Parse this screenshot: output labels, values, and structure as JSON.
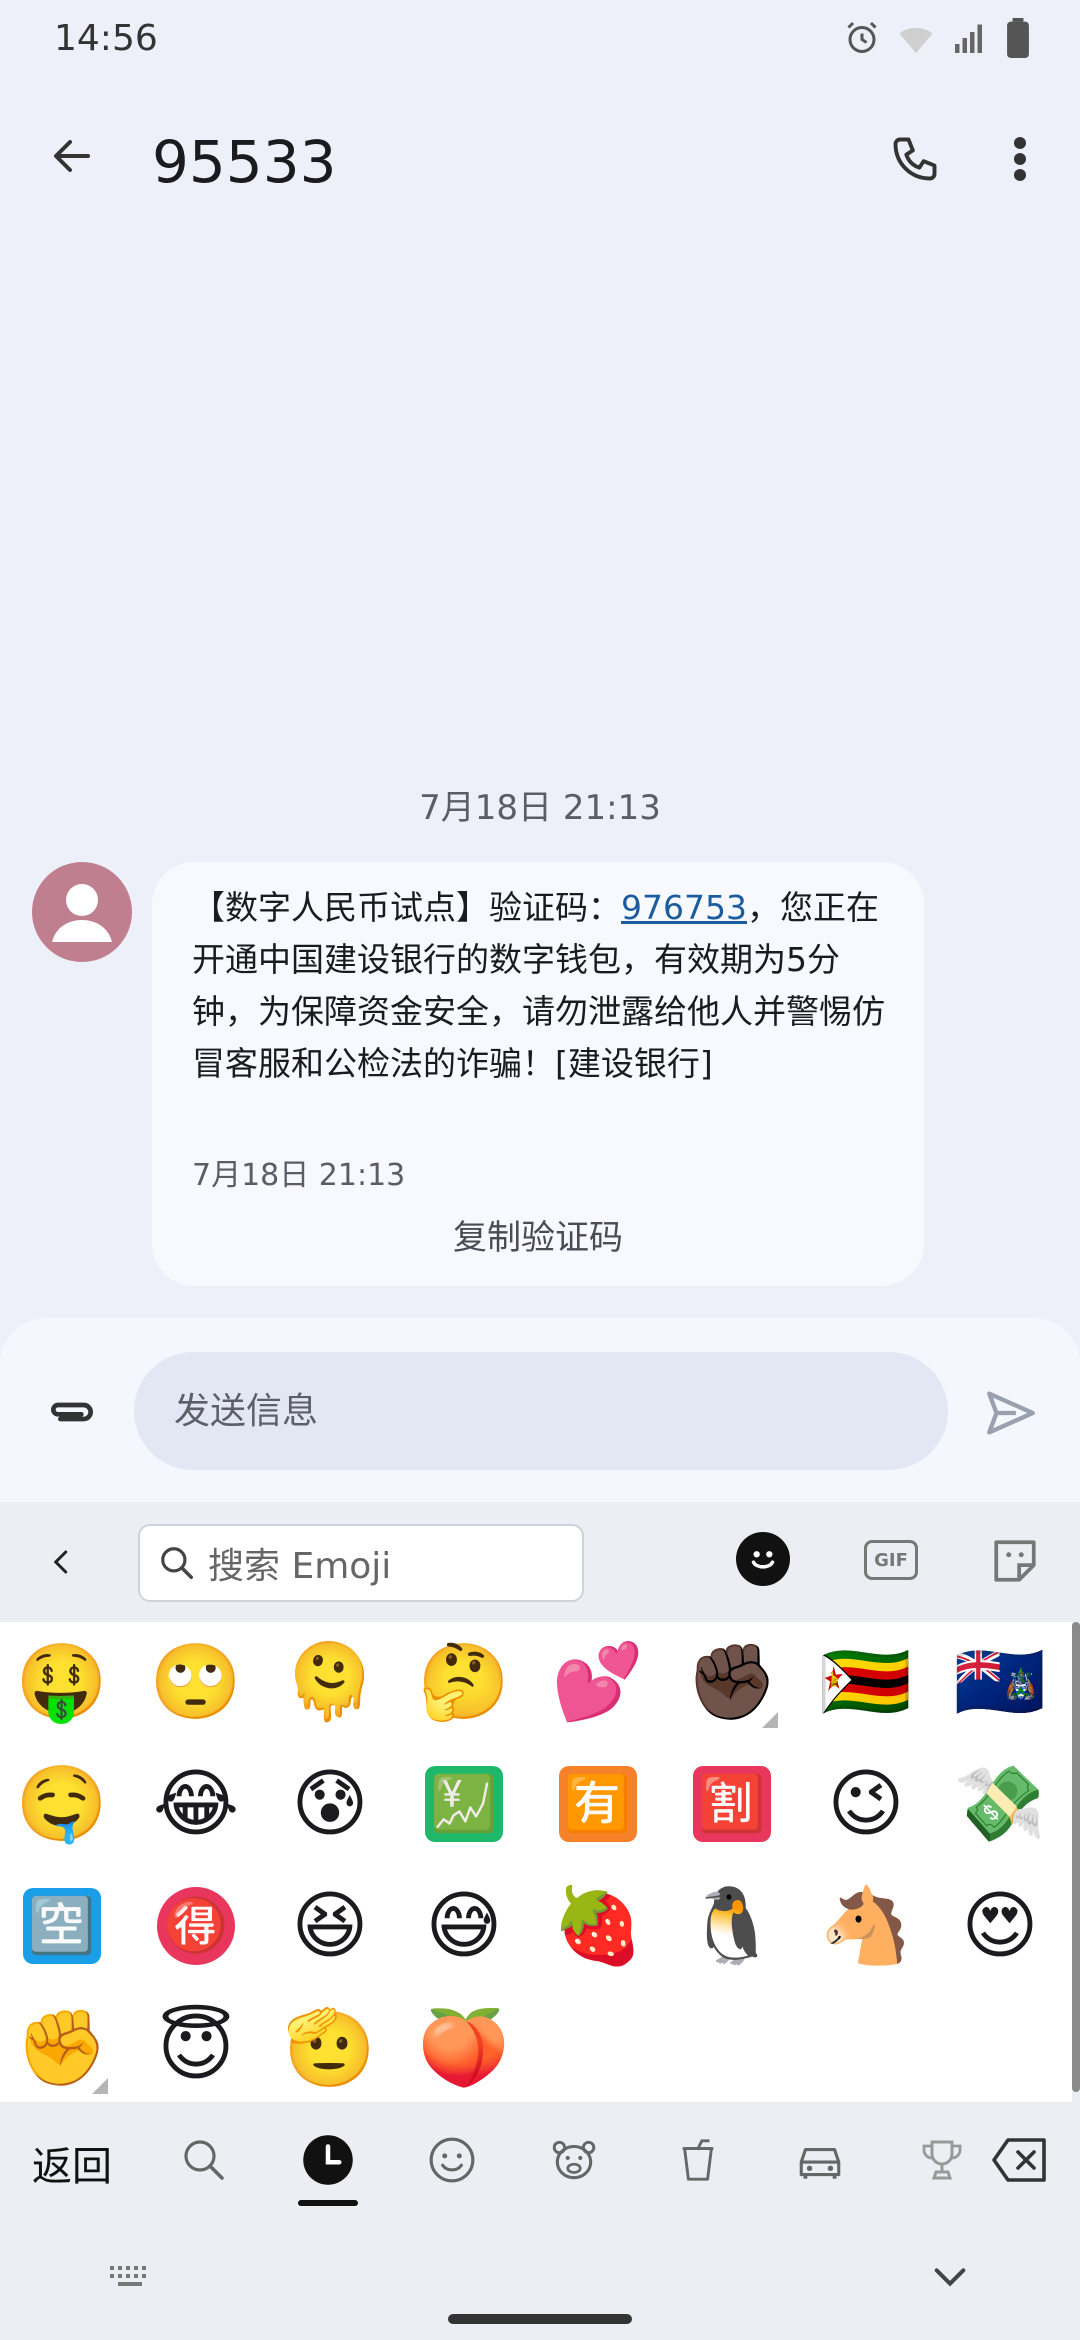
{
  "status_bar": {
    "time": "14:56"
  },
  "app_bar": {
    "title": "95533"
  },
  "conversation": {
    "date_separator": "7月18日 21:13",
    "message": {
      "text_before_code": "【数字人民币试点】验证码：",
      "code": "976753",
      "text_after_code": "，您正在开通中国建设银行的数字钱包，有效期为5分钟，为保障资金安全，请勿泄露给他人并警惕仿冒客服和公检法的诈骗！[建设银行]",
      "time": "7月18日 21:13",
      "copy_code_label": "复制验证码"
    }
  },
  "composer": {
    "placeholder": "发送信息"
  },
  "keyboard": {
    "search_placeholder": "搜索 Emoji",
    "gif_label": "GIF",
    "return_label": "返回",
    "emojis": [
      "🤑",
      "🙄",
      "🫠",
      "🤔",
      "💕",
      "✊🏿",
      "🇿🇼",
      "🇦🇨",
      "🤤",
      "😂",
      "😰",
      "💹",
      "🈶",
      "🈹",
      "😉",
      "💸",
      "🈳",
      "🉐",
      "😆",
      "😅",
      "🍓",
      "🐧",
      "🐴",
      "😍",
      "✊",
      "😇",
      "🫡",
      "🍑"
    ]
  }
}
